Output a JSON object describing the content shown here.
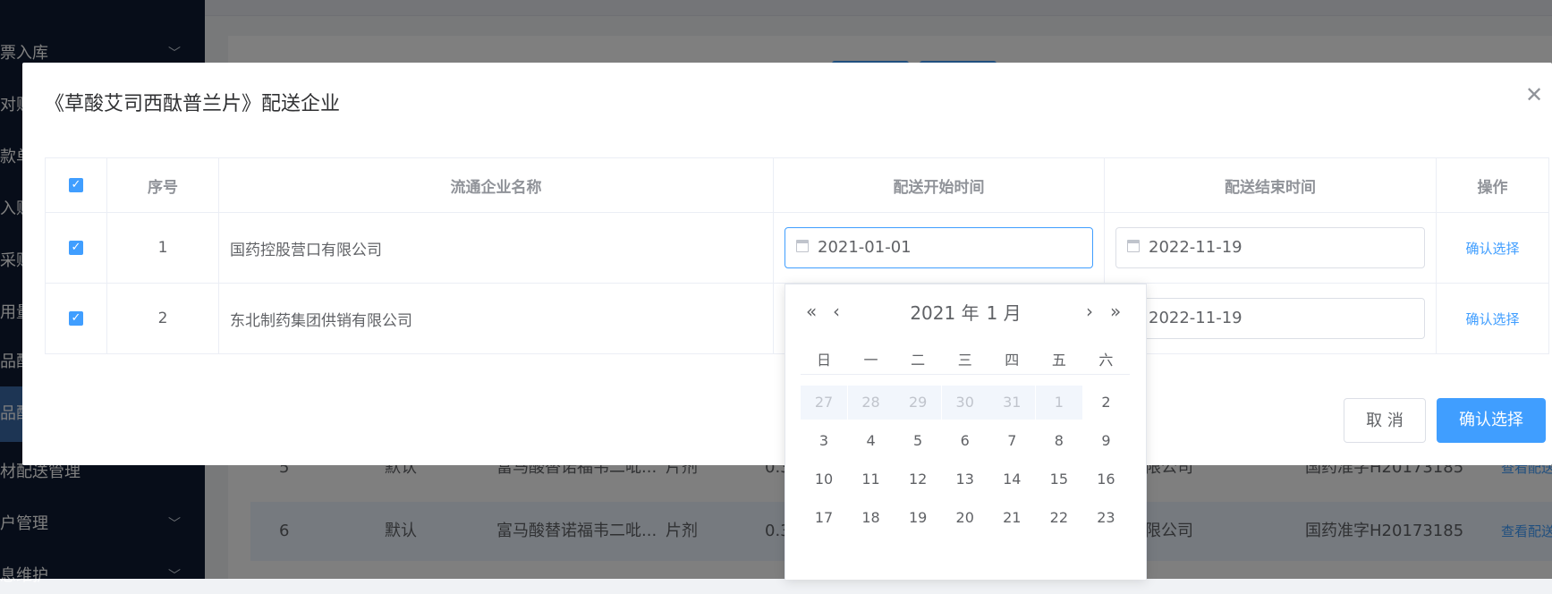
{
  "sidebar": {
    "items": [
      {
        "label": "票入库",
        "chevron": true
      },
      {
        "label": "对账",
        "chevron": false
      },
      {
        "label": "款单",
        "chevron": false
      },
      {
        "label": "入账",
        "chevron": false
      },
      {
        "label": "采购",
        "chevron": false
      },
      {
        "label": "用量",
        "chevron": false
      },
      {
        "label": "品配",
        "chevron": false
      },
      {
        "label": "品配",
        "chevron": false,
        "active": true
      },
      {
        "label": "材配送管理",
        "chevron": false
      },
      {
        "label": "户管理",
        "chevron": true
      },
      {
        "label": "息维护",
        "chevron": true
      }
    ],
    "chevron_icon": "chevron-down-icon"
  },
  "background_table": {
    "rows": [
      {
        "index": "5",
        "type": "默认",
        "name": "富马酸替诺福韦二吡...",
        "form": "片剂",
        "spec": "0.3",
        "company": "限公司",
        "approval": "国药准字H20173185",
        "action": "查看配送"
      },
      {
        "index": "6",
        "type": "默认",
        "name": "富马酸替诺福韦二吡...",
        "form": "片剂",
        "spec": "0.3",
        "company": "限公司",
        "approval": "国药准字H20173185",
        "action": "查看配送"
      }
    ]
  },
  "dialog": {
    "title": "《草酸艾司西酞普兰片》配送企业",
    "close_icon": "close-icon",
    "columns": [
      "序号",
      "流通企业名称",
      "配送开始时间",
      "配送结束时间",
      "操作"
    ],
    "rows": [
      {
        "index": "1",
        "company": "国药控股营口有限公司",
        "start": "2021-01-01",
        "end": "2022-11-19",
        "action": "确认选择",
        "checked": true
      },
      {
        "index": "2",
        "company": "东北制药集团供销有限公司",
        "start": "",
        "end": "2022-11-19",
        "action": "确认选择",
        "checked": true
      }
    ],
    "cancel_label": "取 消",
    "confirm_label": "确认选择"
  },
  "datepicker": {
    "year": "2021 年",
    "month": "1 月",
    "nav": {
      "prev_year": "«",
      "prev_month": "‹",
      "next_month": "›",
      "next_year": "»"
    },
    "weekdays": [
      "日",
      "一",
      "二",
      "三",
      "四",
      "五",
      "六"
    ],
    "weeks": [
      [
        "27",
        "28",
        "29",
        "30",
        "31",
        "1",
        "2"
      ],
      [
        "3",
        "4",
        "5",
        "6",
        "7",
        "8",
        "9"
      ],
      [
        "10",
        "11",
        "12",
        "13",
        "14",
        "15",
        "16"
      ],
      [
        "17",
        "18",
        "19",
        "20",
        "21",
        "22",
        "23"
      ]
    ],
    "prev_month_days": 6
  },
  "colors": {
    "primary": "#409eff",
    "sidebar": "#0e1b33",
    "sidebar_active": "#3a6aa8"
  }
}
